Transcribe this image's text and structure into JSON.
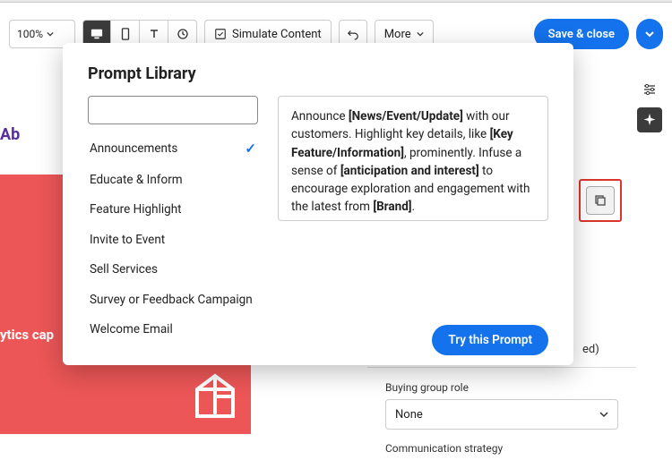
{
  "toolbar": {
    "zoom": "100%",
    "simulate": "Simulate Content",
    "more": "More",
    "save_close": "Save & close"
  },
  "bg": {
    "ab_text": "Ab",
    "ytics_text": "ytics cap"
  },
  "float": {
    "label": "copy"
  },
  "panel": {
    "hint_suffix": "ed)",
    "buying_group_label": "Buying group role",
    "buying_group_value": "None",
    "comm_strategy_label": "Communication strategy"
  },
  "modal": {
    "title": "Prompt Library",
    "search_placeholder": "",
    "try_label": "Try this Prompt",
    "items": [
      {
        "label": "Announcements",
        "selected": true
      },
      {
        "label": "Educate & Inform",
        "selected": false
      },
      {
        "label": "Feature Highlight",
        "selected": false
      },
      {
        "label": "Invite to Event",
        "selected": false
      },
      {
        "label": "Sell Services",
        "selected": false
      },
      {
        "label": "Survey or Feedback Campaign",
        "selected": false
      },
      {
        "label": "Welcome Email",
        "selected": false
      }
    ],
    "preview": {
      "p1a": "Announce ",
      "p1b": "[News/Event/Update]",
      "p1c": " with our customers. Highlight key details, like ",
      "p1d": "[Key Feature/Information]",
      "p1e": ", prominently. Infuse a sense of ",
      "p1f": "[anticipation and interest]",
      "p1g": " to encourage exploration and engagement with the latest from ",
      "p1h": "[Brand]",
      "p1i": "."
    }
  }
}
